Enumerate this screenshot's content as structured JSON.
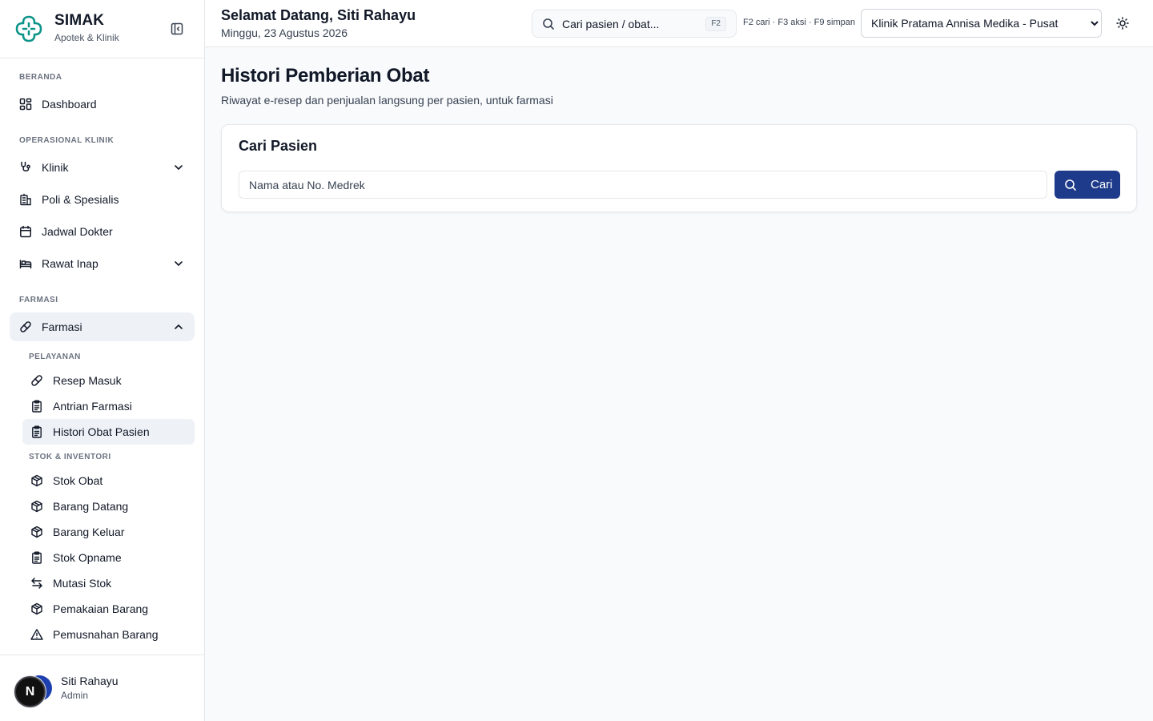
{
  "brand": {
    "name": "SIMAK",
    "subtitle": "Apotek & Klinik",
    "accent": "#0d9488"
  },
  "sidebar": {
    "sections": {
      "beranda": "BERANDA",
      "operasional": "OPERASIONAL KLINIK",
      "farmasi": "FARMASI",
      "pelayanan": "PELAYANAN",
      "stok": "STOK & INVENTORI"
    },
    "items": {
      "dashboard": "Dashboard",
      "klinik": "Klinik",
      "poli": "Poli & Spesialis",
      "jadwal": "Jadwal Dokter",
      "rawat_inap": "Rawat Inap",
      "farmasi": "Farmasi"
    },
    "sub_items": {
      "resep_masuk": "Resep Masuk",
      "antrian_farmasi": "Antrian Farmasi",
      "histori_obat": "Histori Obat Pasien",
      "stok_obat": "Stok Obat",
      "barang_datang": "Barang Datang",
      "barang_keluar": "Barang Keluar",
      "stok_opname": "Stok Opname",
      "mutasi_stok": "Mutasi Stok",
      "pemakaian_barang": "Pemakaian Barang",
      "pemusnahan_barang": "Pemusnahan Barang"
    }
  },
  "user": {
    "name": "Siti Rahayu",
    "role": "Admin",
    "avatar_letter": "N"
  },
  "header": {
    "greeting": "Selamat Datang, Siti Rahayu",
    "date": "Minggu, 23 Agustus 2026",
    "search_placeholder": "Cari pasien / obat...",
    "search_shortcut": "F2",
    "shortcuts_hint": "F2 cari · F3 aksi · F9 simpan",
    "clinic_selected": "Klinik Pratama Annisa Medika - Pusat"
  },
  "main": {
    "title": "Histori Pemberian Obat",
    "subtitle": "Riwayat e-resep dan penjualan langsung per pasien, untuk farmasi",
    "card_title": "Cari Pasien",
    "input_placeholder": "Nama atau No. Medrek",
    "search_button": "Cari",
    "button_color": "#1e3a8a"
  }
}
